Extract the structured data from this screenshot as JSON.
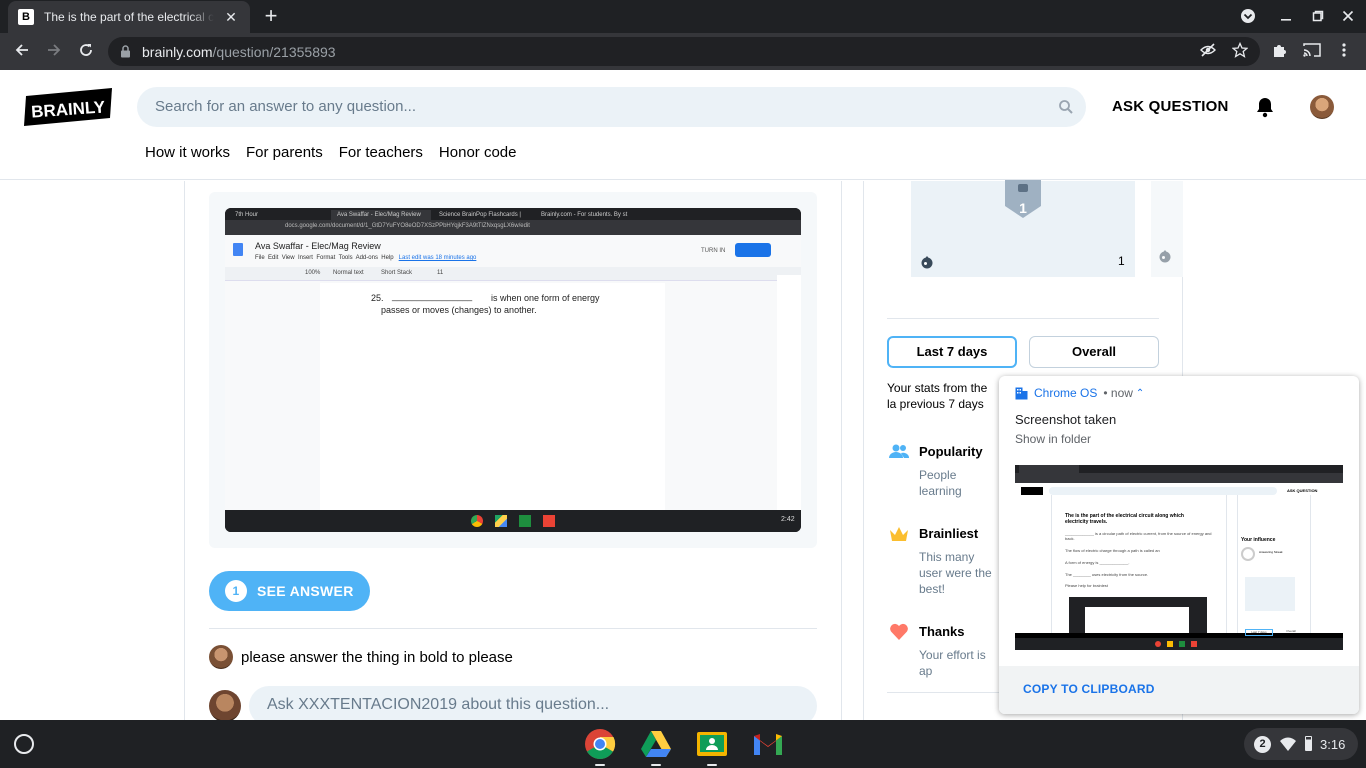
{
  "browser": {
    "tab_title": "The is the part of the electrical ci",
    "tab_favicon": "B",
    "url_domain": "brainly.com",
    "url_path": "/question/21355893",
    "new_tab_icon": "plus-icon",
    "close_icon": "close-icon"
  },
  "header": {
    "search_placeholder": "Search for an answer to any question...",
    "ask_label": "ASK QUESTION",
    "nav": [
      "How it works",
      "For parents",
      "For teachers",
      "Honor code"
    ],
    "logo_text": "BRAINLY"
  },
  "main": {
    "see_answer_count": "1",
    "see_answer_label": "SEE ANSWER",
    "comment": "please answer the thing in bold to please",
    "ask_placeholder": "Ask XXXTENTACION2019 about this question..."
  },
  "embedded_screenshot": {
    "tabs": [
      "7th Hour",
      "Ava Swaffar - Elec/Mag Review",
      "Science BrainPop Flashcards |",
      "Brainly.com - For students. By st"
    ],
    "url": "docs.google.com/document/d/1_GtD7YuFYO8eOD7XSzPPbHYqjkF3A9tTlZNxqsgLX6w/edit",
    "doc_title": "Ava Swaffar - Elec/Mag Review",
    "menu": [
      "File",
      "Edit",
      "View",
      "Insert",
      "Format",
      "Tools",
      "Add-ons",
      "Help"
    ],
    "last_edit": "Last edit was 18 minutes ago",
    "turn_in": "TURN IN",
    "zoom": "100%",
    "style": "Normal text",
    "font": "Short Stack",
    "size": "11",
    "line_num": "25.",
    "blank": "________________",
    "line1_rest": "is when one form of energy",
    "line2": "passes or moves (changes) to another.",
    "time": "2:42"
  },
  "sidebar": {
    "shield_count": "1",
    "count_right": "1",
    "tab_week": "Last 7 days",
    "tab_overall": "Overall",
    "stats_text": "Your stats from the la previous 7 days",
    "stats": [
      {
        "title": "Popularity",
        "desc": "People learning"
      },
      {
        "title": "Brainliest",
        "desc": "This many user were the best!"
      },
      {
        "title": "Thanks",
        "desc": "Your effort is ap"
      }
    ]
  },
  "notification": {
    "app": "Chrome OS",
    "time": "now",
    "title": "Screenshot taken",
    "subtitle": "Show in folder",
    "action": "COPY TO CLIPBOARD",
    "thumb": {
      "question": "The is the part of the electrical circuit along which electricity travels.",
      "lines": [
        "_____________ is a circular path of electric current, from the source of energy and back.",
        "The flow of electric charge through a path is called an",
        "A form of energy is _____________.",
        "The ________ uses electricity from the source.",
        "Please help for brainlest"
      ],
      "infl": "Your influence",
      "answering": "Answering Streak",
      "tab_a": "Last 7 days",
      "tab_b": "Overall",
      "ask": "ASK QUESTION"
    }
  },
  "shelf": {
    "apps": [
      "chrome-icon",
      "google-drive-icon",
      "google-classroom-icon",
      "gmail-icon"
    ],
    "badge": "2",
    "time": "3:16"
  },
  "colors": {
    "accent": "#4fb3f6",
    "chrome_dark": "#35363a",
    "shelf": "#1f2124",
    "search_bg": "#ebf2f7",
    "notification_link": "#1a73e8"
  }
}
